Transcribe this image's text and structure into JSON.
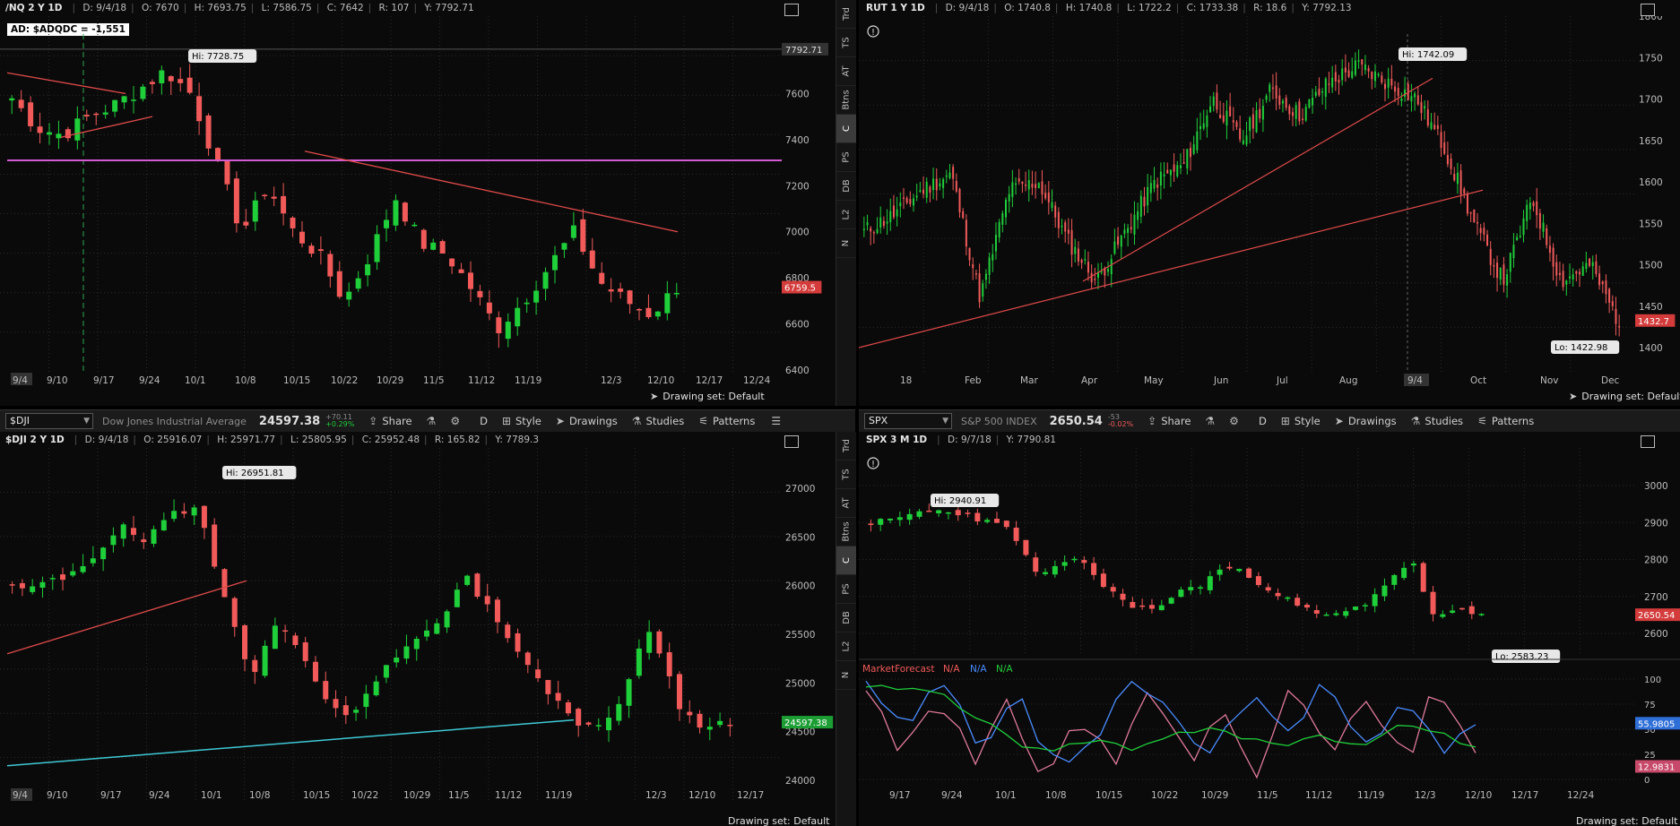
{
  "panels": {
    "nq": {
      "header": {
        "symbol": "/NQ 2 Y 1D",
        "date": "D: 9/4/18",
        "open": "O: 7670",
        "high": "H: 7693.75",
        "low": "L: 7586.75",
        "close": "C: 7642",
        "range": "R: 107",
        "ycursor": "Y: 7792.71"
      },
      "study_label": "AD: $ADQDC = -1,551",
      "hi_label": "Hi: 7728.75",
      "price_labels": [
        "7600",
        "7400",
        "7200",
        "7000",
        "6800",
        "6600",
        "6400"
      ],
      "cursor_price": "7792.71",
      "last_price": "6759.5",
      "x_labels": [
        "9/4",
        "9/10",
        "9/17",
        "9/24",
        "10/1",
        "10/8",
        "10/15",
        "10/22",
        "10/29",
        "11/5",
        "11/12",
        "11/19",
        "12/3",
        "12/10",
        "12/17",
        "12/24"
      ],
      "drawing_set": "Drawing set: Default"
    },
    "rut": {
      "header": {
        "symbol": "RUT 1 Y 1D",
        "date": "D: 9/4/18",
        "open": "O: 1740.8",
        "high": "H: 1740.8",
        "low": "L: 1722.2",
        "close": "C: 1733.38",
        "range": "R: 18.6",
        "ycursor": "Y: 7792.13"
      },
      "hi_label": "Hi: 1742.09",
      "lo_label": "Lo: 1422.98",
      "price_labels": [
        "1800",
        "1750",
        "1700",
        "1650",
        "1600",
        "1550",
        "1500",
        "1450",
        "1400"
      ],
      "last_price": "1432.7",
      "x_labels": [
        "18",
        "Feb",
        "Mar",
        "Apr",
        "May",
        "Jun",
        "Jul",
        "Aug",
        "9/4",
        "Oct",
        "Nov",
        "Dec"
      ],
      "drawing_set": "Drawing set: Default"
    },
    "dji": {
      "toolbar": {
        "symbol": "$DJI",
        "description": "Dow Jones Industrial Average",
        "price": "24597.38",
        "change": "+70.11",
        "change_pct": "+0.29%",
        "period": "D"
      },
      "header": {
        "symbol": "$DJI 2 Y 1D",
        "date": "D: 9/4/18",
        "open": "O: 25916.07",
        "high": "H: 25971.77",
        "low": "L: 25805.95",
        "close": "C: 25952.48",
        "range": "R: 165.82",
        "ycursor": "Y: 7789.3"
      },
      "hi_label": "Hi: 26951.81",
      "price_labels": [
        "27000",
        "26500",
        "26000",
        "25500",
        "25000",
        "24500",
        "24000"
      ],
      "last_price": "24597.38",
      "x_labels": [
        "9/4",
        "9/10",
        "9/17",
        "9/24",
        "10/1",
        "10/8",
        "10/15",
        "10/22",
        "10/29",
        "11/5",
        "11/12",
        "11/19",
        "12/3",
        "12/10",
        "12/17"
      ],
      "drawing_set": "Drawing set: Default"
    },
    "spx": {
      "toolbar": {
        "symbol": "SPX",
        "description": "S&P 500 INDEX",
        "price": "2650.54",
        "change": "-53",
        "change_pct": "-0.02%",
        "period": "D"
      },
      "header": {
        "symbol": "SPX 3 M 1D",
        "date": "D: 9/7/18",
        "ycursor": "Y: 7790.81"
      },
      "hi_label": "Hi: 2940.91",
      "lo_label": "Lo: 2583.23",
      "price_labels": [
        "3000",
        "2900",
        "2800",
        "2700",
        "2600"
      ],
      "last_price": "2650.54",
      "study": {
        "name": "MarketForecast",
        "v1": "N/A",
        "v2": "N/A",
        "v3": "N/A",
        "levels": [
          "100",
          "75",
          "50",
          "25",
          "0"
        ],
        "val_blue": "55.9805",
        "val_red": "12.9831"
      },
      "x_labels": [
        "9/17",
        "9/24",
        "10/1",
        "10/8",
        "10/15",
        "10/22",
        "10/29",
        "11/5",
        "11/12",
        "11/19",
        "12/3",
        "12/10",
        "12/17",
        "12/24"
      ],
      "drawing_set": "Drawing set: Default"
    }
  },
  "toolbar_common": {
    "share": "Share",
    "style": "Style",
    "drawings": "Drawings",
    "studies": "Studies",
    "patterns": "Patterns"
  },
  "side_tabs": [
    "Trd",
    "TS",
    "AT",
    "Btns",
    "C",
    "PS",
    "DB",
    "L2",
    "N"
  ],
  "colors": {
    "up": "#1fcf3a",
    "down": "#f25a5a",
    "grid": "#2a2a2a",
    "magenta": "#d45ad4",
    "cyan": "#3fc9d6",
    "trend": "#e04a4a"
  }
}
